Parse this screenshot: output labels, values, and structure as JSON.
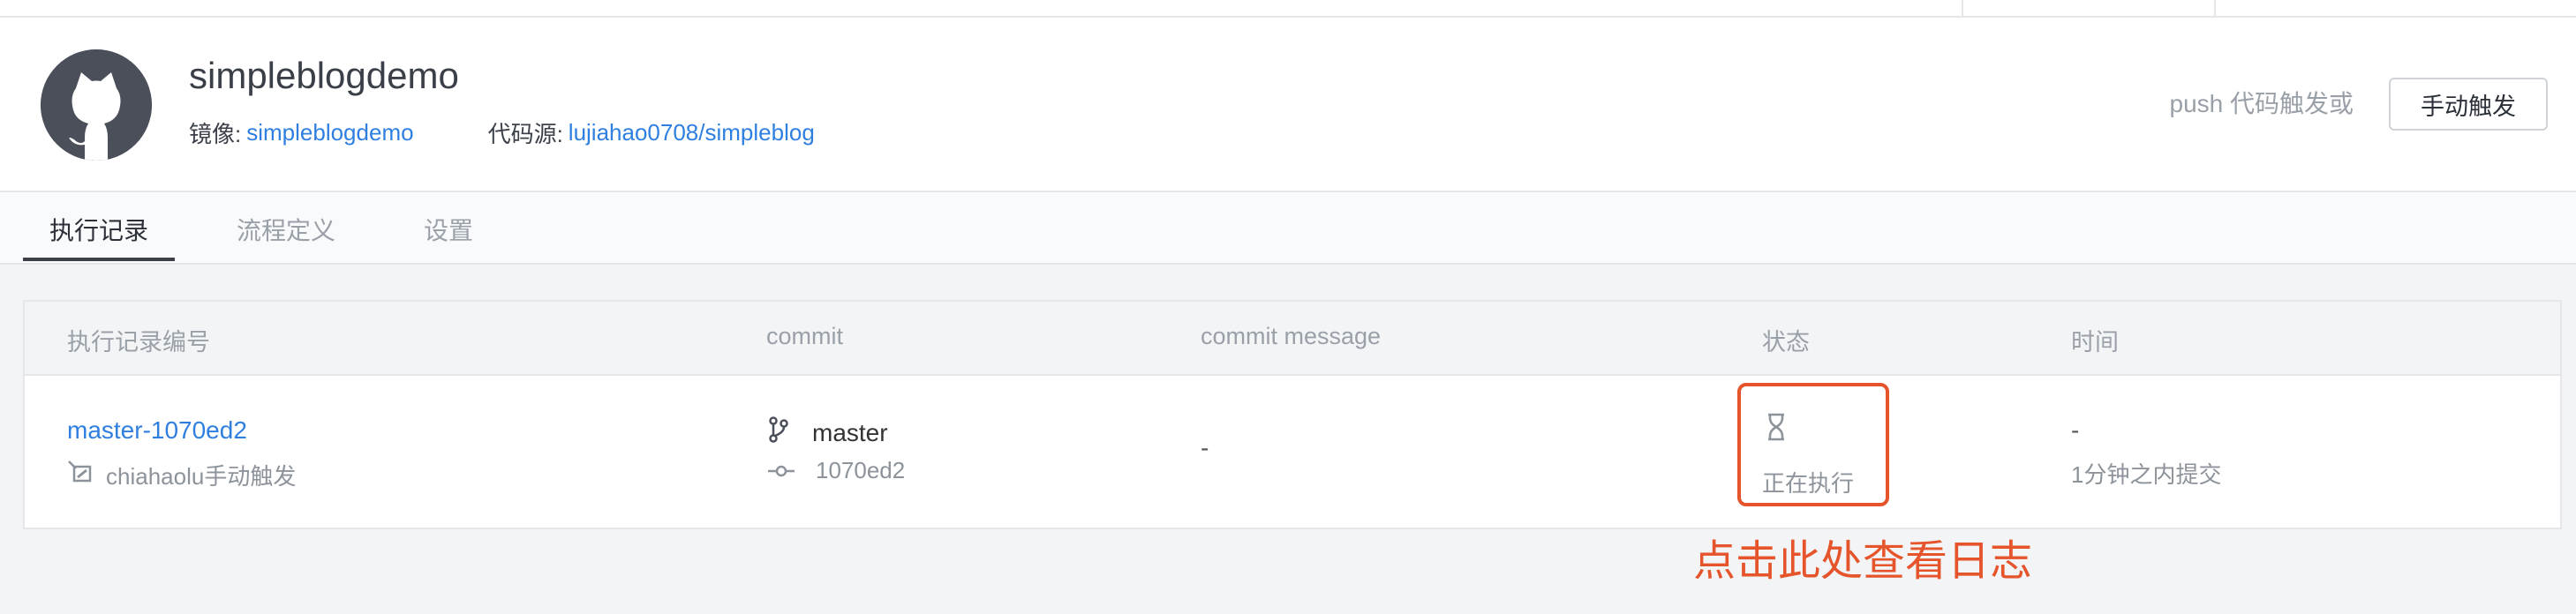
{
  "project": {
    "name": "simpleblogdemo",
    "image_label": "镜像:",
    "image_value": "simpleblogdemo",
    "source_label": "代码源:",
    "source_value": "lujiahao0708/simpleblog"
  },
  "header_actions": {
    "hint": "push 代码触发或",
    "trigger_button": "手动触发"
  },
  "tabs": [
    {
      "label": "执行记录",
      "active": true
    },
    {
      "label": "流程定义",
      "active": false
    },
    {
      "label": "设置",
      "active": false
    }
  ],
  "table": {
    "columns": [
      "执行记录编号",
      "commit",
      "commit message",
      "状态",
      "时间"
    ],
    "rows": [
      {
        "run_id": "master-1070ed2",
        "triggered_by": "chiahaolu手动触发",
        "branch": "master",
        "commit_hash": "1070ed2",
        "commit_message": "-",
        "status": "正在执行",
        "time": "-",
        "time_detail": "1分钟之内提交"
      }
    ]
  },
  "annotation": {
    "text": "点击此处查看日志",
    "color": "#e5542a"
  },
  "colors": {
    "link": "#2f7fe0",
    "annotation": "#e5542a"
  }
}
